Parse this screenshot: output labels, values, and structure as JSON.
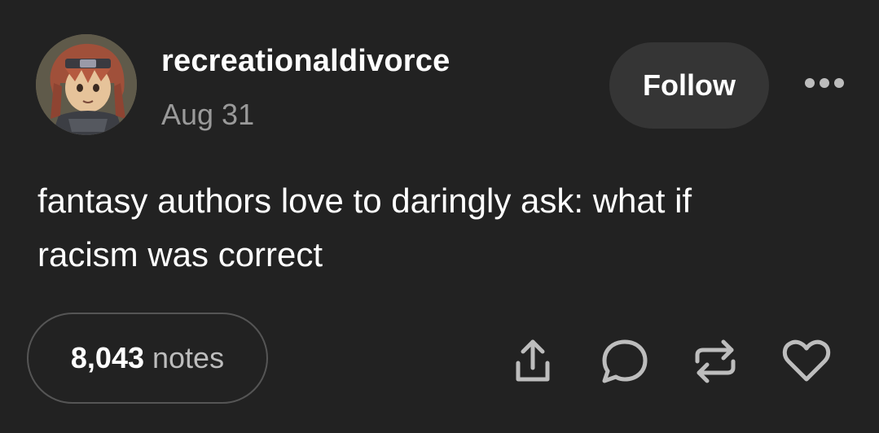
{
  "post": {
    "username": "recreationaldivorce",
    "date": "Aug 31",
    "follow_label": "Follow",
    "text_line1": "fantasy authors love to daringly ask: what if",
    "text_line2": "racism was correct",
    "notes_count": "8,043",
    "notes_label": "notes"
  },
  "icons": {
    "more": "more-horizontal-icon",
    "share": "share-icon",
    "reply": "reply-icon",
    "reblog": "reblog-icon",
    "like": "heart-icon"
  },
  "colors": {
    "background": "#222222",
    "follow_button": "#353535",
    "secondary_text": "#9a9a9a",
    "icon": "#bdbdbd"
  }
}
